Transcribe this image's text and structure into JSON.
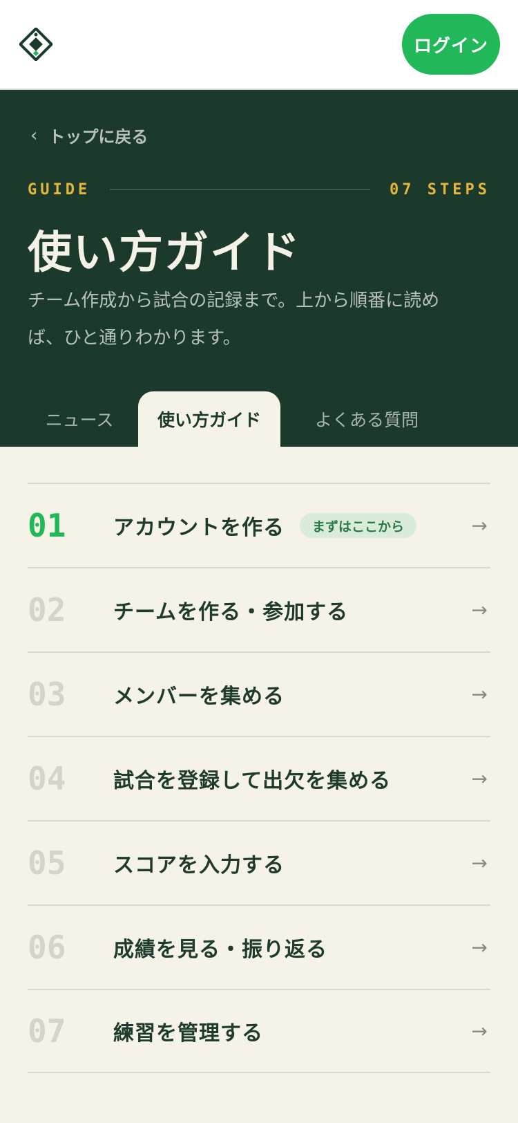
{
  "header": {
    "login_label": "ログイン",
    "logo_icon": "diamond-logo-icon"
  },
  "hero": {
    "back_label": "トップに戻る",
    "guide_label": "GUIDE",
    "steps_label": "07 STEPS",
    "title": "使い方ガイド",
    "description": "チーム作成から試合の記録まで。上から順番に読めば、ひと通りわかります。"
  },
  "tabs": [
    {
      "label": "ニュース",
      "active": false
    },
    {
      "label": "使い方ガイド",
      "active": true
    },
    {
      "label": "よくある質問",
      "active": false
    }
  ],
  "steps": [
    {
      "num": "01",
      "title": "アカウントを作る",
      "badge": "まずはここから"
    },
    {
      "num": "02",
      "title": "チームを作る・参加する"
    },
    {
      "num": "03",
      "title": "メンバーを集める"
    },
    {
      "num": "04",
      "title": "試合を登録して出欠を集める"
    },
    {
      "num": "05",
      "title": "スコアを入力する"
    },
    {
      "num": "06",
      "title": "成績を見る・振り返る"
    },
    {
      "num": "07",
      "title": "練習を管理する"
    }
  ],
  "colors": {
    "accent": "#22b85a",
    "hero_bg": "#1b3a2b",
    "gold": "#e6b63a",
    "page_bg": "#f5f2e8"
  }
}
